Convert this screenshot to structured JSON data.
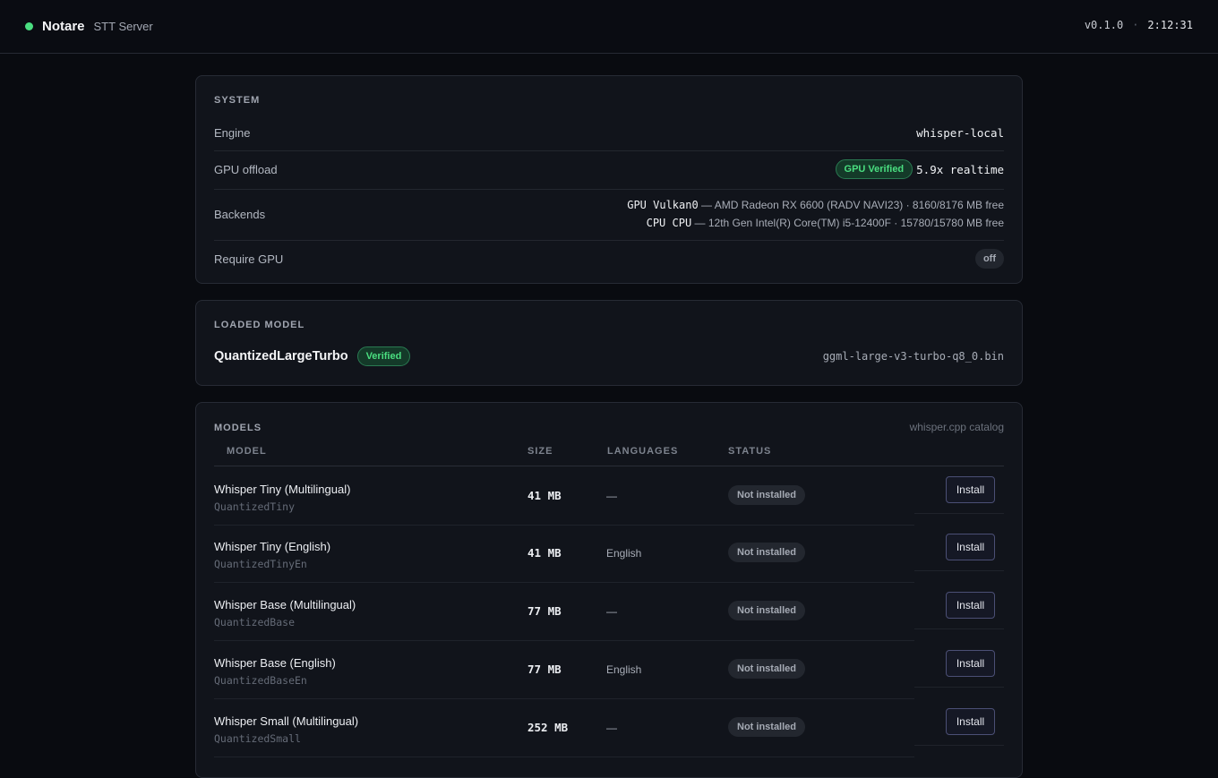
{
  "header": {
    "app_name": "Notare",
    "app_subtitle": "STT Server",
    "version": "v0.1.0",
    "separator": "·",
    "clock": "2:12:31"
  },
  "system": {
    "title": "SYSTEM",
    "engine_label": "Engine",
    "engine_value": "whisper-local",
    "gpu_offload_label": "GPU offload",
    "gpu_badge": "GPU Verified",
    "gpu_speed": "5.9x realtime",
    "backends_label": "Backends",
    "backends": [
      {
        "name": "GPU Vulkan0",
        "detail": " — AMD Radeon RX 6600 (RADV NAVI23) · 8160/8176 MB free"
      },
      {
        "name": "CPU CPU",
        "detail": " — 12th Gen Intel(R) Core(TM) i5-12400F · 15780/15780 MB free"
      }
    ],
    "require_gpu_label": "Require GPU",
    "require_gpu_value": "off"
  },
  "loaded_model": {
    "title": "LOADED MODEL",
    "name": "QuantizedLargeTurbo",
    "badge": "Verified",
    "file": "ggml-large-v3-turbo-q8_0.bin"
  },
  "models": {
    "title": "MODELS",
    "catalog_note": "whisper.cpp catalog",
    "columns": [
      "MODEL",
      "SIZE",
      "LANGUAGES",
      "STATUS"
    ],
    "rows": [
      {
        "name": "Whisper Tiny (Multilingual)",
        "id": "QuantizedTiny",
        "size": "41 MB",
        "languages": "—",
        "status": "Not installed",
        "action": "Install"
      },
      {
        "name": "Whisper Tiny (English)",
        "id": "QuantizedTinyEn",
        "size": "41 MB",
        "languages": "English",
        "status": "Not installed",
        "action": "Install"
      },
      {
        "name": "Whisper Base (Multilingual)",
        "id": "QuantizedBase",
        "size": "77 MB",
        "languages": "—",
        "status": "Not installed",
        "action": "Install"
      },
      {
        "name": "Whisper Base (English)",
        "id": "QuantizedBaseEn",
        "size": "77 MB",
        "languages": "English",
        "status": "Not installed",
        "action": "Install"
      },
      {
        "name": "Whisper Small (Multilingual)",
        "id": "QuantizedSmall",
        "size": "252 MB",
        "languages": "—",
        "status": "Not installed",
        "action": "Install"
      }
    ]
  },
  "colors": {
    "accent_green": "#4ade80",
    "background": "#090b10",
    "card": "#11141b",
    "button_border": "#4b4f75"
  }
}
